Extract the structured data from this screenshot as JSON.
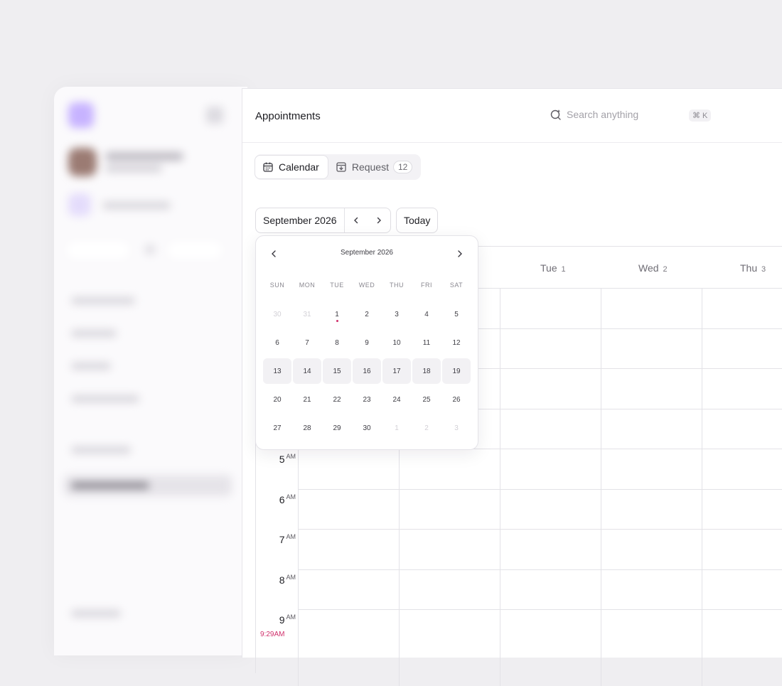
{
  "header": {
    "title": "Appointments",
    "search_placeholder": "Search anything",
    "search_shortcut": "⌘ K"
  },
  "tabs": [
    {
      "label": "Calendar",
      "icon": "calendar-icon",
      "active": true
    },
    {
      "label": "Request",
      "icon": "inbox-download-icon",
      "count": "12",
      "active": false
    }
  ],
  "toolbar": {
    "month_label": "September 2026",
    "today_label": "Today"
  },
  "week_columns": [
    {
      "day": "Tue",
      "date": "1"
    },
    {
      "day": "Wed",
      "date": "2"
    },
    {
      "day": "Thu",
      "date": "3"
    }
  ],
  "time_labels": [
    {
      "hour": "5",
      "period": "AM"
    },
    {
      "hour": "6",
      "period": "AM"
    },
    {
      "hour": "7",
      "period": "AM"
    },
    {
      "hour": "8",
      "period": "AM"
    },
    {
      "hour": "9",
      "period": "AM"
    }
  ],
  "current_time": "9:29AM",
  "datepicker": {
    "title": "September 2026",
    "weekdays": [
      "SUN",
      "MON",
      "TUE",
      "WED",
      "THU",
      "FRI",
      "SAT"
    ],
    "weeks": [
      [
        "30",
        "31",
        "1",
        "2",
        "3",
        "4",
        "5"
      ],
      [
        "6",
        "7",
        "8",
        "9",
        "10",
        "11",
        "12"
      ],
      [
        "13",
        "14",
        "15",
        "16",
        "17",
        "18",
        "19"
      ],
      [
        "20",
        "21",
        "22",
        "23",
        "24",
        "25",
        "26"
      ],
      [
        "27",
        "28",
        "29",
        "30",
        "1",
        "2",
        "3"
      ]
    ],
    "muted": [
      [
        0,
        0
      ],
      [
        0,
        1
      ],
      [
        4,
        4
      ],
      [
        4,
        5
      ],
      [
        4,
        6
      ]
    ],
    "selected_week_index": 2,
    "today": [
      0,
      2
    ]
  },
  "colors": {
    "accent_today": "#d0306b",
    "selected_week_bg": "#f2f1f4",
    "page_bg": "#efeef1"
  }
}
